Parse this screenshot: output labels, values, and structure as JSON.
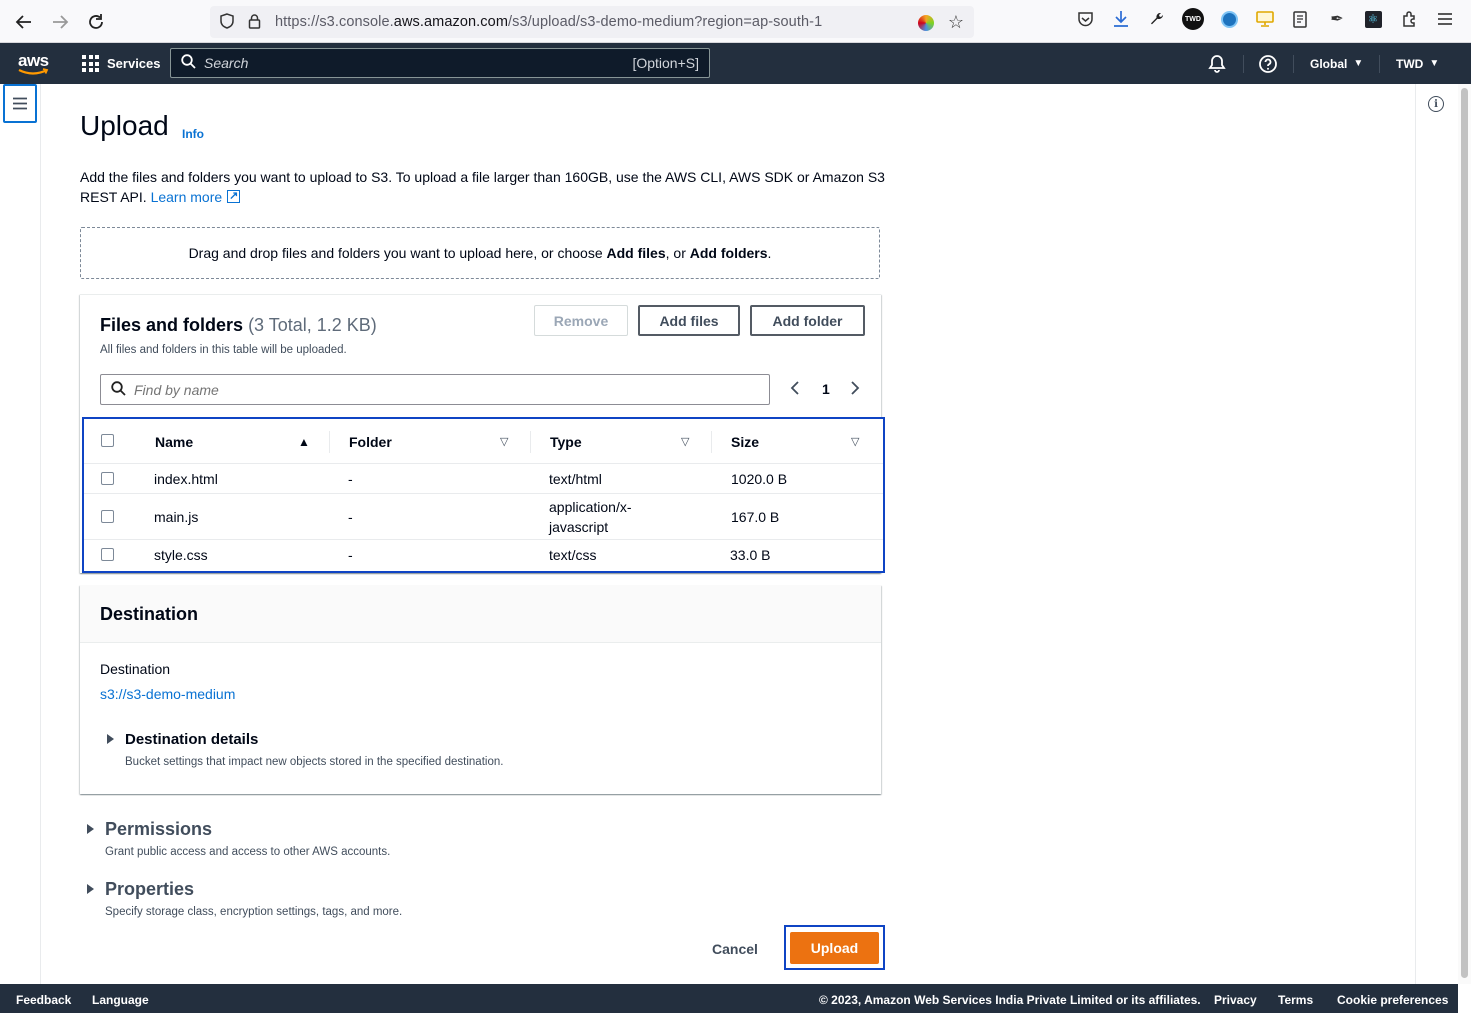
{
  "browser": {
    "url_prefix": "https://s3.console.",
    "url_domain": "aws.amazon.com",
    "url_path": "/s3/upload/s3-demo-medium?region=ap-south-1",
    "extension_badge": "TWD"
  },
  "aws_header": {
    "logo": "aws",
    "services_label": "Services",
    "search_placeholder": "Search",
    "search_shortcut": "[Option+S]",
    "region_label": "Global",
    "account_label": "TWD"
  },
  "page": {
    "title": "Upload",
    "info_label": "Info",
    "description": "Add the files and folders you want to upload to S3. To upload a file larger than 160GB, use the AWS CLI, AWS SDK or Amazon S3 REST API.",
    "learn_more": "Learn more",
    "dropzone_prefix": "Drag and drop files and folders you want to upload here, or choose ",
    "dropzone_add_files": "Add files",
    "dropzone_mid": ", or ",
    "dropzone_add_folders": "Add folders",
    "dropzone_suffix": "."
  },
  "files_panel": {
    "title": "Files and folders",
    "count": "(3 Total, 1.2 KB)",
    "subtitle": "All files and folders in this table will be uploaded.",
    "remove_label": "Remove",
    "add_files_label": "Add files",
    "add_folder_label": "Add folder",
    "find_placeholder": "Find by name",
    "page_number": "1",
    "columns": [
      "Name",
      "Folder",
      "Type",
      "Size"
    ],
    "rows": [
      {
        "name": "index.html",
        "folder": "-",
        "type": "text/html",
        "size": "1020.0 B"
      },
      {
        "name": "main.js",
        "folder": "-",
        "type": "application/x-javascript",
        "size": "167.0 B"
      },
      {
        "name": "style.css",
        "folder": "-",
        "type": "text/css",
        "size": "33.0 B"
      }
    ]
  },
  "destination": {
    "title": "Destination",
    "label": "Destination",
    "bucket_link": "s3://s3-demo-medium",
    "details_title": "Destination details",
    "details_sub": "Bucket settings that impact new objects stored in the specified destination."
  },
  "permissions": {
    "title": "Permissions",
    "sub": "Grant public access and access to other AWS accounts."
  },
  "properties": {
    "title": "Properties",
    "sub": "Specify storage class, encryption settings, tags, and more."
  },
  "actions": {
    "cancel_label": "Cancel",
    "upload_label": "Upload"
  },
  "footer": {
    "feedback": "Feedback",
    "language": "Language",
    "copyright": "© 2023, Amazon Web Services India Private Limited or its affiliates.",
    "privacy": "Privacy",
    "terms": "Terms",
    "cookies": "Cookie preferences"
  },
  "colors": {
    "aws_nav": "#232f3e",
    "link_blue": "#0972d3",
    "focus_outline": "#0f44c4",
    "primary_orange": "#ec7211"
  },
  "icons": [
    "back-arrow-icon",
    "forward-arrow-icon",
    "reload-icon",
    "shield-icon",
    "lock-icon",
    "star-icon",
    "pocket-icon",
    "download-icon",
    "wrench-icon",
    "grid-icon",
    "search-icon",
    "bell-icon",
    "help-icon",
    "menu-icon",
    "info-circle-icon",
    "external-link-icon",
    "sort-asc-icon",
    "sort-desc-icon",
    "chevron-left-icon",
    "chevron-right-icon",
    "caret-right-icon"
  ]
}
